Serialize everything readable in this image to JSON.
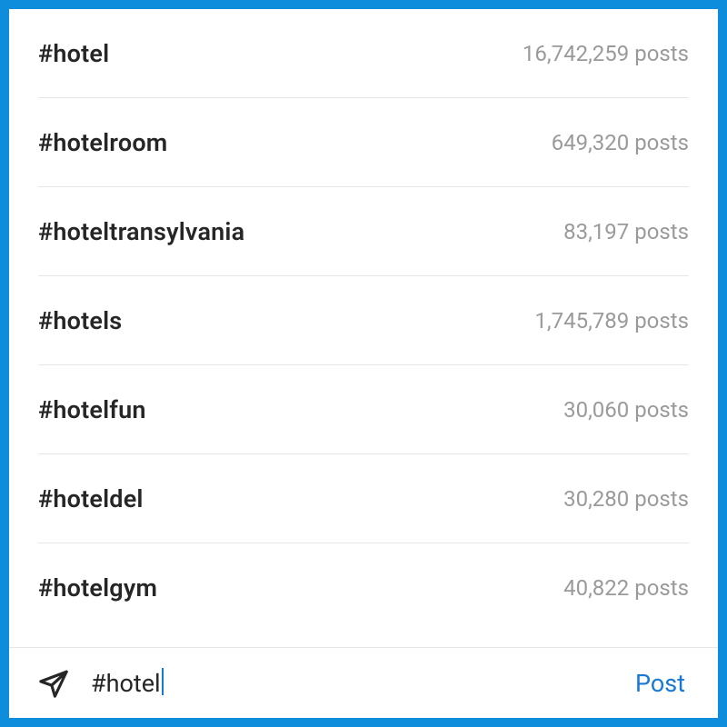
{
  "suggestions": [
    {
      "tag": "#hotel",
      "count": "16,742,259 posts"
    },
    {
      "tag": "#hotelroom",
      "count": "649,320 posts"
    },
    {
      "tag": "#hoteltransylvania",
      "count": "83,197 posts"
    },
    {
      "tag": "#hotels",
      "count": "1,745,789 posts"
    },
    {
      "tag": "#hotelfun",
      "count": "30,060 posts"
    },
    {
      "tag": "#hoteldel",
      "count": "30,280 posts"
    },
    {
      "tag": "#hotelgym",
      "count": "40,822 posts"
    }
  ],
  "composer": {
    "text": "#hotel",
    "post_label": "Post"
  }
}
